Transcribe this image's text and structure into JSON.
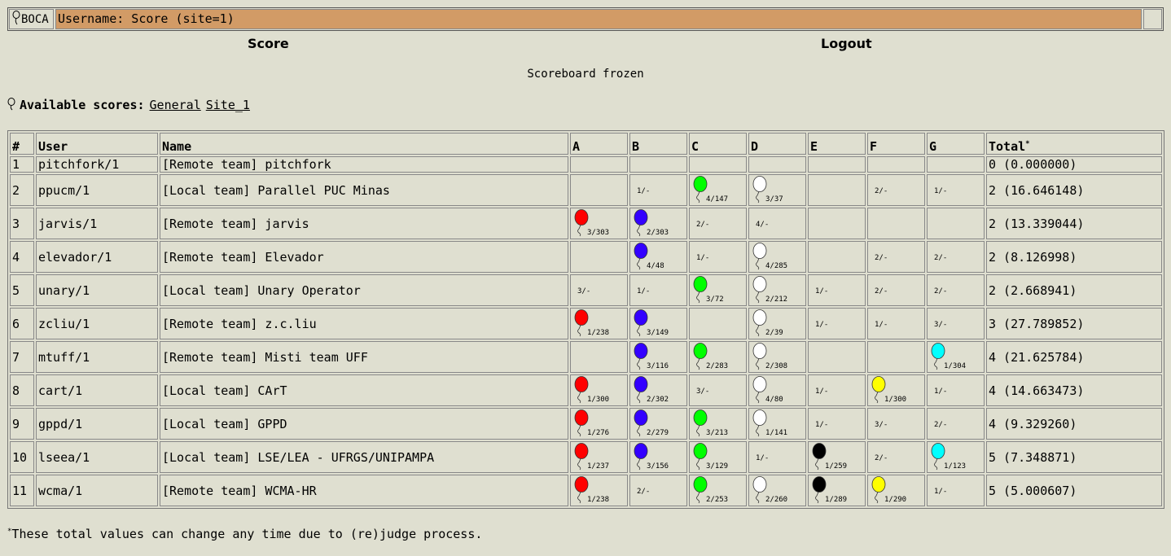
{
  "header": {
    "logo": "BOCA",
    "title": "Username: Score (site=1)"
  },
  "nav": {
    "score": "Score",
    "logout": "Logout"
  },
  "status": "Scoreboard frozen",
  "available": {
    "label": "Available scores:",
    "links": [
      "General",
      "Site_1"
    ]
  },
  "table": {
    "headers": [
      "#",
      "User",
      "Name",
      "A",
      "B",
      "C",
      "D",
      "E",
      "F",
      "G",
      "Total"
    ],
    "total_mark": "*",
    "balloon_colors": {
      "red": "#ff0000",
      "blue": "#3300ff",
      "green": "#00ff00",
      "white": "#ffffff",
      "black": "#000000",
      "yellow": "#ffff00",
      "cyan": "#00ffff"
    },
    "rows": [
      {
        "rank": "1",
        "user": "pitchfork/1",
        "name": "[Remote team] pitchfork",
        "p": [
          null,
          null,
          null,
          null,
          null,
          null,
          null
        ],
        "total": "0 (0.000000)"
      },
      {
        "rank": "2",
        "user": "ppucm/1",
        "name": "[Local team] Parallel PUC Minas",
        "p": [
          null,
          {
            "t": "1/-"
          },
          {
            "t": "4/147",
            "c": "green"
          },
          {
            "t": "3/37",
            "c": "white"
          },
          null,
          {
            "t": "2/-"
          },
          {
            "t": "1/-"
          }
        ],
        "total": "2 (16.646148)"
      },
      {
        "rank": "3",
        "user": "jarvis/1",
        "name": "[Remote team] jarvis",
        "p": [
          {
            "t": "3/303",
            "c": "red"
          },
          {
            "t": "2/303",
            "c": "blue"
          },
          {
            "t": "2/-"
          },
          {
            "t": "4/-"
          },
          null,
          null,
          null
        ],
        "total": "2 (13.339044)"
      },
      {
        "rank": "4",
        "user": "elevador/1",
        "name": "[Remote team] Elevador",
        "p": [
          null,
          {
            "t": "4/48",
            "c": "blue"
          },
          {
            "t": "1/-"
          },
          {
            "t": "4/285",
            "c": "white"
          },
          null,
          {
            "t": "2/-"
          },
          {
            "t": "2/-"
          }
        ],
        "total": "2 (8.126998)"
      },
      {
        "rank": "5",
        "user": "unary/1",
        "name": "[Local team] Unary Operator",
        "p": [
          {
            "t": "3/-"
          },
          {
            "t": "1/-"
          },
          {
            "t": "3/72",
            "c": "green"
          },
          {
            "t": "2/212",
            "c": "white"
          },
          {
            "t": "1/-"
          },
          {
            "t": "2/-"
          },
          {
            "t": "2/-"
          }
        ],
        "total": "2 (2.668941)"
      },
      {
        "rank": "6",
        "user": "zcliu/1",
        "name": "[Remote team] z.c.liu",
        "p": [
          {
            "t": "1/238",
            "c": "red"
          },
          {
            "t": "3/149",
            "c": "blue"
          },
          null,
          {
            "t": "2/39",
            "c": "white"
          },
          {
            "t": "1/-"
          },
          {
            "t": "1/-"
          },
          {
            "t": "3/-"
          }
        ],
        "total": "3 (27.789852)"
      },
      {
        "rank": "7",
        "user": "mtuff/1",
        "name": "[Remote team] Misti team UFF",
        "p": [
          null,
          {
            "t": "3/116",
            "c": "blue"
          },
          {
            "t": "2/283",
            "c": "green"
          },
          {
            "t": "2/308",
            "c": "white"
          },
          null,
          null,
          {
            "t": "1/304",
            "c": "cyan"
          }
        ],
        "total": "4 (21.625784)"
      },
      {
        "rank": "8",
        "user": "cart/1",
        "name": "[Local team] CArT",
        "p": [
          {
            "t": "1/300",
            "c": "red"
          },
          {
            "t": "2/302",
            "c": "blue"
          },
          {
            "t": "3/-"
          },
          {
            "t": "4/80",
            "c": "white"
          },
          {
            "t": "1/-"
          },
          {
            "t": "1/300",
            "c": "yellow"
          },
          {
            "t": "1/-"
          }
        ],
        "total": "4 (14.663473)"
      },
      {
        "rank": "9",
        "user": "gppd/1",
        "name": "[Local team] GPPD",
        "p": [
          {
            "t": "1/276",
            "c": "red"
          },
          {
            "t": "2/279",
            "c": "blue"
          },
          {
            "t": "3/213",
            "c": "green"
          },
          {
            "t": "1/141",
            "c": "white"
          },
          {
            "t": "1/-"
          },
          {
            "t": "3/-"
          },
          {
            "t": "2/-"
          }
        ],
        "total": "4 (9.329260)"
      },
      {
        "rank": "10",
        "user": "lseea/1",
        "name": "[Local team] LSE/LEA - UFRGS/UNIPAMPA",
        "p": [
          {
            "t": "1/237",
            "c": "red"
          },
          {
            "t": "3/156",
            "c": "blue"
          },
          {
            "t": "3/129",
            "c": "green"
          },
          {
            "t": "1/-"
          },
          {
            "t": "1/259",
            "c": "black"
          },
          {
            "t": "2/-"
          },
          {
            "t": "1/123",
            "c": "cyan"
          }
        ],
        "total": "5 (7.348871)"
      },
      {
        "rank": "11",
        "user": "wcma/1",
        "name": "[Remote team] WCMA-HR",
        "p": [
          {
            "t": "1/238",
            "c": "red"
          },
          {
            "t": "2/-"
          },
          {
            "t": "2/253",
            "c": "green"
          },
          {
            "t": "2/260",
            "c": "white"
          },
          {
            "t": "1/289",
            "c": "black"
          },
          {
            "t": "1/290",
            "c": "yellow"
          },
          {
            "t": "1/-"
          }
        ],
        "total": "5 (5.000607)"
      }
    ]
  },
  "footnote": {
    "mark": "*",
    "text": "These total values can change any time due to (re)judge process."
  }
}
